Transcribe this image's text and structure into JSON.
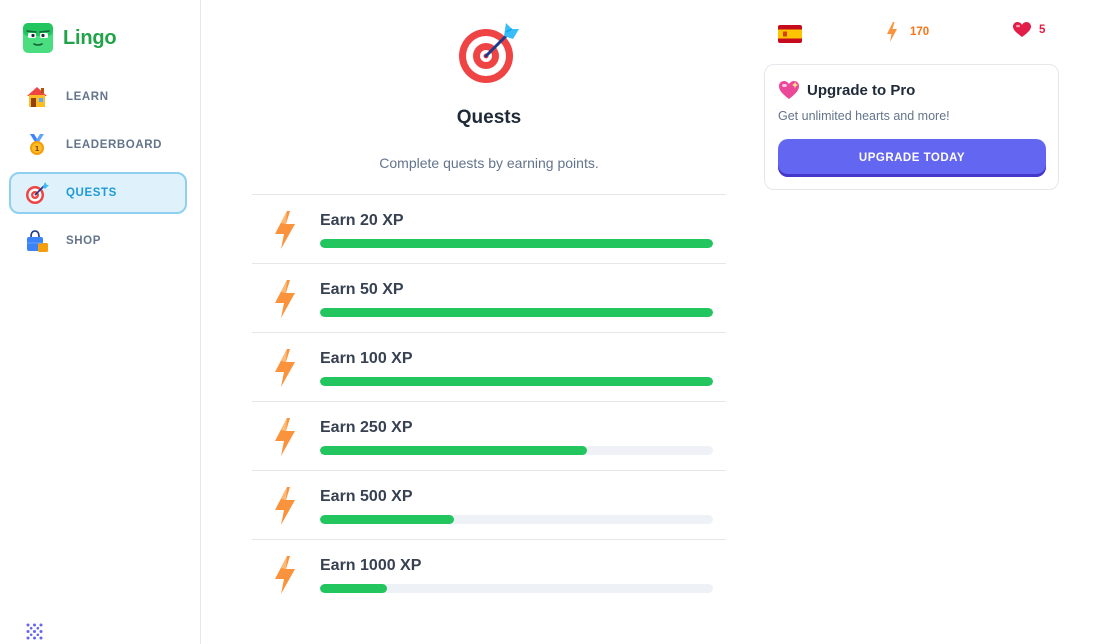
{
  "brand": {
    "name": "Lingo",
    "logo_icon": "green-mascot-logo"
  },
  "sidebar": {
    "items": [
      {
        "label": "LEARN",
        "icon": "house-icon",
        "active": false
      },
      {
        "label": "LEADERBOARD",
        "icon": "medal-icon",
        "active": false
      },
      {
        "label": "QUESTS",
        "icon": "target-icon",
        "active": true
      },
      {
        "label": "SHOP",
        "icon": "shopping-bag-icon",
        "active": false
      }
    ],
    "bottom_icon": "dots-grid-icon"
  },
  "main": {
    "icon": "target-arrow-icon",
    "title": "Quests",
    "subtitle": "Complete quests by earning points.",
    "quests": [
      {
        "title": "Earn 20 XP",
        "progress": 1.0
      },
      {
        "title": "Earn 50 XP",
        "progress": 1.0
      },
      {
        "title": "Earn 100 XP",
        "progress": 1.0
      },
      {
        "title": "Earn 250 XP",
        "progress": 0.68
      },
      {
        "title": "Earn 500 XP",
        "progress": 0.34
      },
      {
        "title": "Earn 1000 XP",
        "progress": 0.17
      }
    ]
  },
  "header": {
    "language_flag": "spain-flag-icon",
    "xp_points": "170",
    "hearts": "5"
  },
  "pro_card": {
    "title": "Upgrade to Pro",
    "text": "Get unlimited hearts and more!",
    "button_label": "UPGRADE TODAY"
  },
  "colors": {
    "brand_green": "#22a34a",
    "progress_green": "#22c55e",
    "active_nav_bg": "#dff1fb",
    "active_nav_text": "#1e9bd7",
    "xp_orange": "#f97316",
    "heart_red": "#e11d48",
    "button_indigo": "#6366f1"
  }
}
